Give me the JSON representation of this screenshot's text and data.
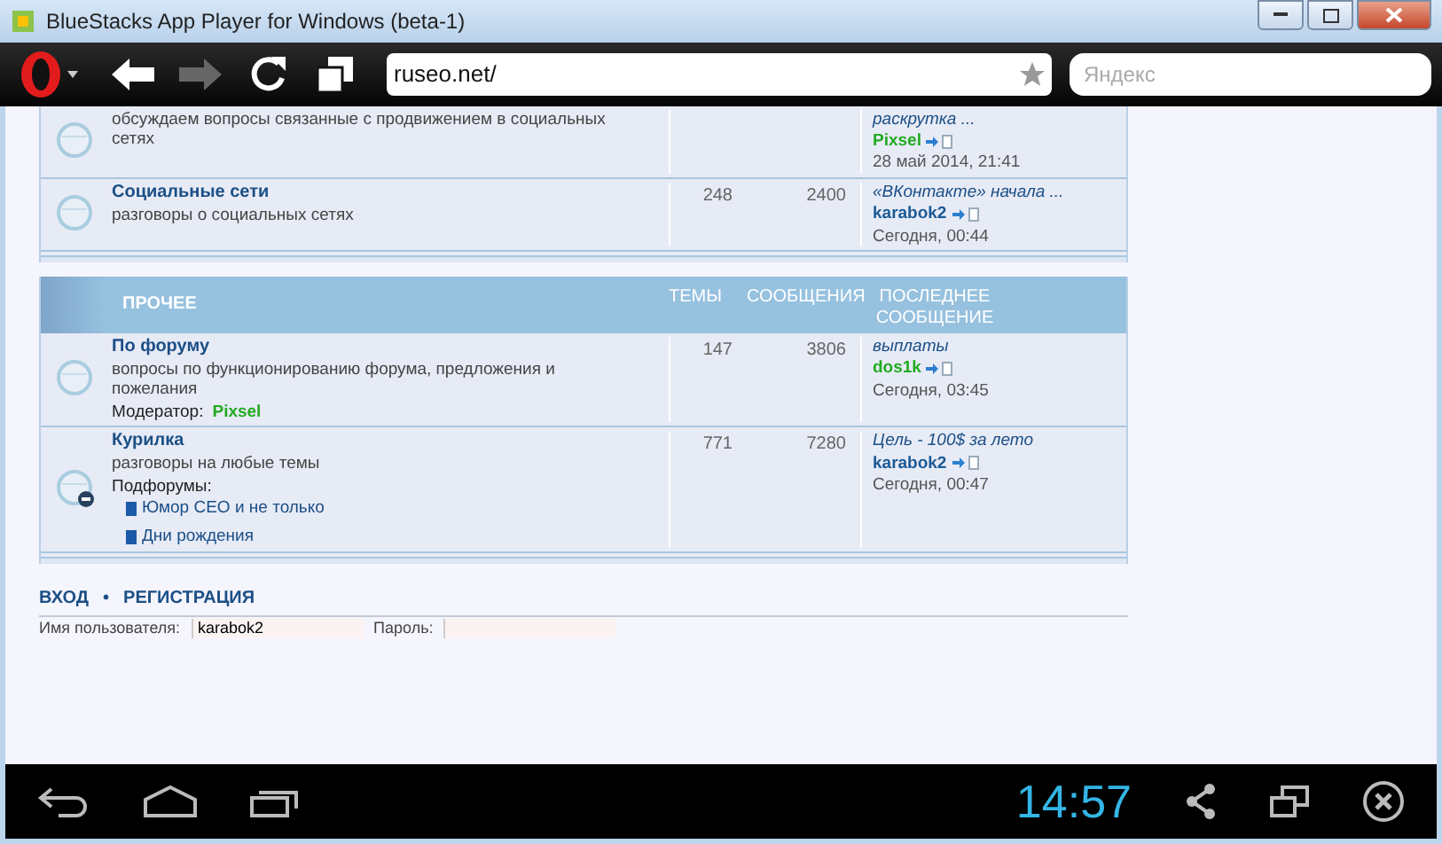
{
  "window": {
    "title": "BlueStacks App Player for Windows (beta-1)"
  },
  "browser": {
    "nav_buttons": [
      {
        "kind": "back",
        "disabled": false
      },
      {
        "kind": "forward",
        "disabled": true
      },
      {
        "kind": "reload",
        "disabled": false
      },
      {
        "kind": "tabs",
        "disabled": false
      }
    ],
    "address": "ruseo.net/",
    "search": {
      "placeholder": "Яндекс"
    }
  },
  "sections": [
    {
      "rows": [
        {
          "kind": "plain",
          "description": "обсуждаем вопросы связанные с продвижением в социальных сетях",
          "last_post": {
            "topic": "раскрутка ...",
            "author": "Pixsel",
            "color": "#22aa22",
            "date": "28 май 2014, 21:41"
          }
        },
        {
          "kind": "plain",
          "title": "Социальные сети",
          "description": "разговоры о социальных сетях",
          "topics": "248",
          "posts": "2400",
          "last_post": {
            "topic": "«ВКонтакте» начала ...",
            "author": "karabok2",
            "color": "#1a5a96",
            "date": "Сегодня, 00:44"
          }
        }
      ]
    },
    {
      "header": {
        "title": "ПРОЧЕЕ",
        "topics": "ТЕМЫ",
        "posts": "СООБЩЕНИЯ",
        "last_post": "ПОСЛЕДНЕЕ СООБЩЕНИЕ"
      },
      "rows": [
        {
          "kind": "plain",
          "title": "По форуму",
          "description": "вопросы по функционированию форума, предложения и пожелания",
          "moderator_label": "Модератор:",
          "moderator": "Pixsel",
          "topics": "147",
          "posts": "3806",
          "last_post": {
            "topic": "выплаты",
            "author": "dos1k",
            "color": "#22aa22",
            "date": "Сегодня, 03:45"
          }
        },
        {
          "kind": "badged",
          "title": "Курилка",
          "description": "разговоры на любые темы",
          "subforums_label": "Подфорумы:",
          "subforums": [
            "Юмор СЕО и не только",
            "Дни рождения"
          ],
          "topics": "771",
          "posts": "7280",
          "last_post": {
            "topic": "Цель - 100$ за лето",
            "author": "karabok2",
            "color": "#1a5a96",
            "date": "Сегодня, 00:47"
          }
        }
      ]
    }
  ],
  "footer": {
    "links": [
      "ВХОД",
      "РЕГИСТРАЦИЯ"
    ],
    "separator": "•",
    "username_label": "Имя пользователя:",
    "username": "karabok2",
    "password_label": "Пароль:"
  },
  "android_bar": {
    "time": "14:57"
  }
}
